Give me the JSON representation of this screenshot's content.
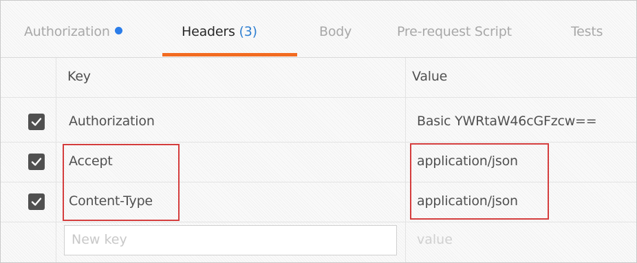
{
  "tabs": [
    {
      "label": "Authorization",
      "has_dot": true
    },
    {
      "label": "Headers",
      "count": "(3)",
      "active": true
    },
    {
      "label": "Body"
    },
    {
      "label": "Pre-request Script"
    },
    {
      "label": "Tests"
    }
  ],
  "table": {
    "columns": {
      "key": "Key",
      "value": "Value"
    },
    "rows": [
      {
        "checked": true,
        "key": "Authorization",
        "value": "Basic YWRtaW46cGFzcw=="
      },
      {
        "checked": true,
        "key": "Accept",
        "value": "application/json"
      },
      {
        "checked": true,
        "key": "Content-Type",
        "value": "application/json"
      }
    ],
    "new_row": {
      "key_placeholder": "New key",
      "value_placeholder": "value"
    }
  },
  "colors": {
    "active_tab_underline": "#f26b21",
    "dot": "#2b7de9",
    "count": "#2f7fd1",
    "highlight": "#d43c3c"
  }
}
